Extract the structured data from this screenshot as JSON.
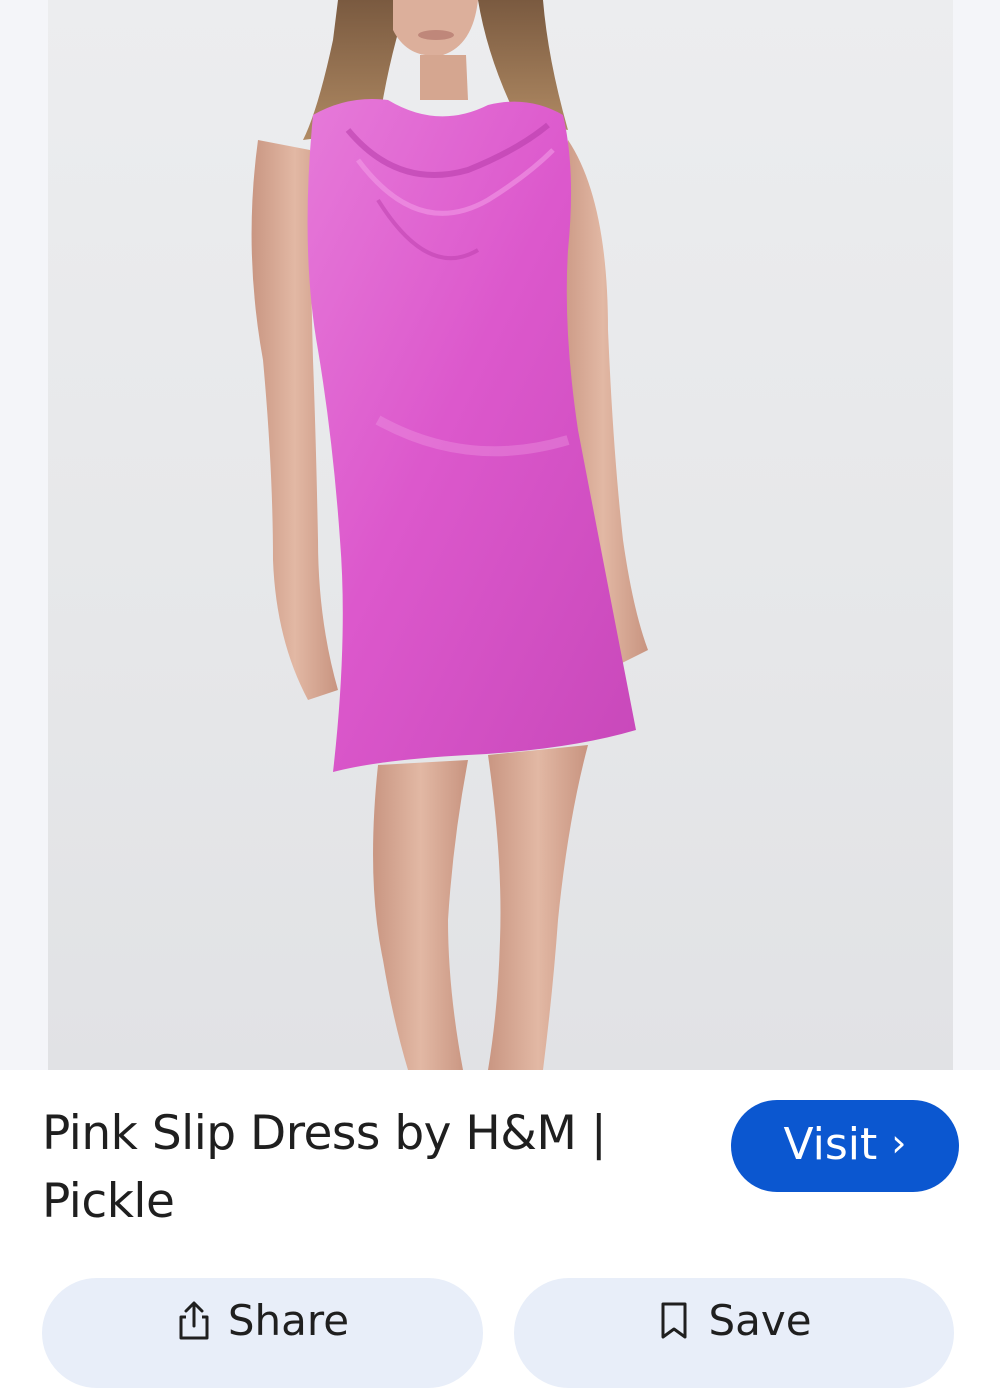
{
  "result": {
    "image_alt": "Model wearing a pink satin cowl-neck slip dress",
    "title": "Pink Slip Dress by H&M | Pickle",
    "visit_label": "Visit",
    "visit_icon": "chevron-right-icon"
  },
  "actions": {
    "share_label": "Share",
    "share_icon": "share-icon",
    "save_label": "Save",
    "save_icon": "bookmark-icon"
  },
  "colors": {
    "accent": "#0b57d0",
    "action_bg": "#e8eef9",
    "dress": "#df5fcf",
    "backdrop": "#e7e8ea"
  }
}
